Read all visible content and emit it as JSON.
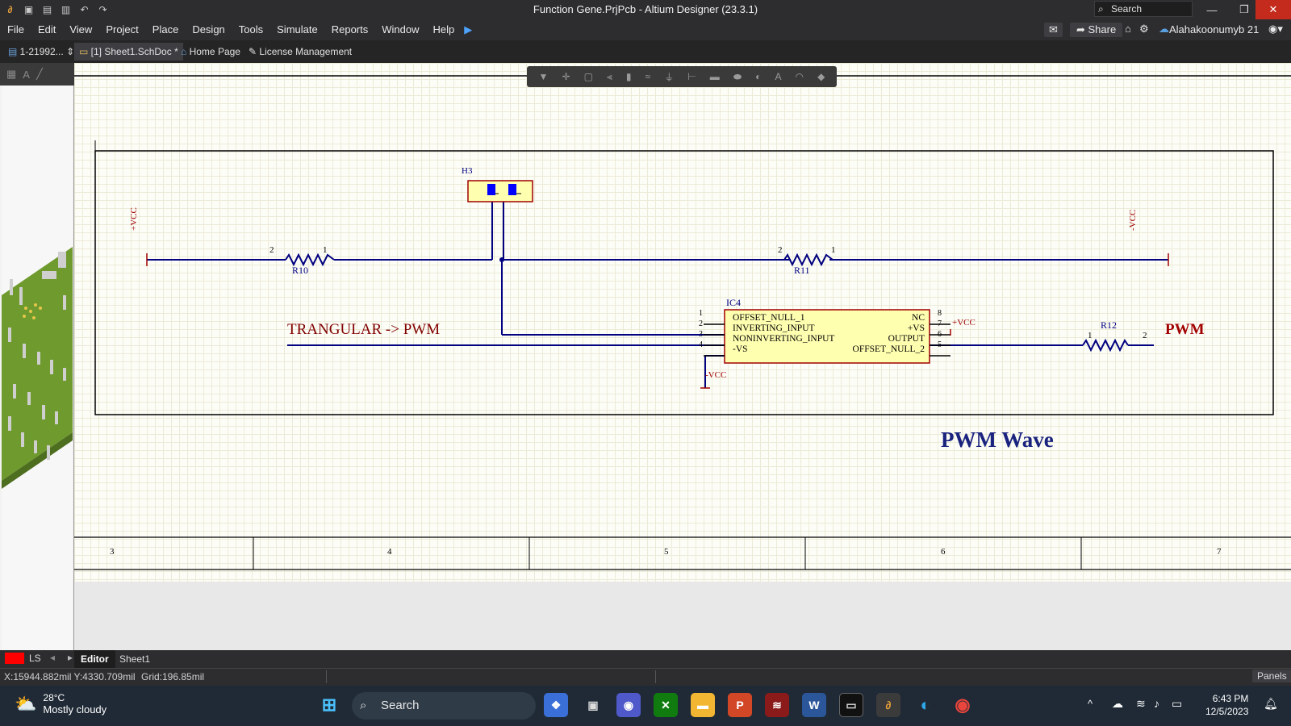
{
  "window": {
    "title": "Function Gene.PrjPcb - Altium Designer (23.3.1)",
    "search_placeholder": "Search"
  },
  "menu": [
    "File",
    "Edit",
    "View",
    "Project",
    "Place",
    "Design",
    "Tools",
    "Simulate",
    "Reports",
    "Window",
    "Help"
  ],
  "menu_right": {
    "share_label": "Share",
    "user_name": "Alahakoonumyb 21"
  },
  "tabs": {
    "project_selector": "1-21992...",
    "active_doc": "[1] Sheet1.SchDoc *",
    "home": "Home Page",
    "license": "License Management"
  },
  "schematic": {
    "components": {
      "h3": "H3",
      "r10": "R10",
      "r11": "R11",
      "r12": "R12",
      "ic4": "IC4"
    },
    "pin_numbers": {
      "r10_left": "2",
      "r10_right": "1",
      "r11_left": "2",
      "r11_right": "1",
      "r12_left": "1",
      "r12_right": "2",
      "ic_left": [
        "1",
        "2",
        "3",
        "4"
      ],
      "ic_right": [
        "8",
        "7",
        "6",
        "5"
      ]
    },
    "ic_pins_left": [
      "OFFSET_NULL_1",
      "INVERTING_INPUT",
      "NONINVERTING_INPUT",
      "-VS"
    ],
    "ic_pins_right": [
      "NC",
      "+VS",
      "OUTPUT",
      "OFFSET_NULL_2"
    ],
    "power": {
      "vcc_plus_left": "+VCC",
      "vcc_minus_right": "-VCC",
      "vcc_plus_ic": "+VCC",
      "vcc_minus_ic": "-VCC"
    },
    "labels": {
      "note": "TRANGULAR -> PWM",
      "output_net": "PWM",
      "sheet_title": "PWM Wave"
    },
    "zone_numbers": [
      "3",
      "4",
      "5",
      "6",
      "7"
    ]
  },
  "bottom_tabs": {
    "ls": "LS",
    "editor": "Editor",
    "sheet": "Sheet1"
  },
  "status": {
    "coords": "X:15944.882mil Y:4330.709mil",
    "grid": "Grid:196.85mil",
    "panels": "Panels"
  },
  "taskbar": {
    "weather_temp": "28°C",
    "weather_desc": "Mostly cloudy",
    "search": "Search",
    "time": "6:43 PM",
    "date": "12/5/2023"
  },
  "colors": {
    "wire": "#000080",
    "component_fill": "#ffffb0",
    "component_border": "#a00000",
    "note_text": "#800000",
    "accent_close": "#c42b1c"
  }
}
